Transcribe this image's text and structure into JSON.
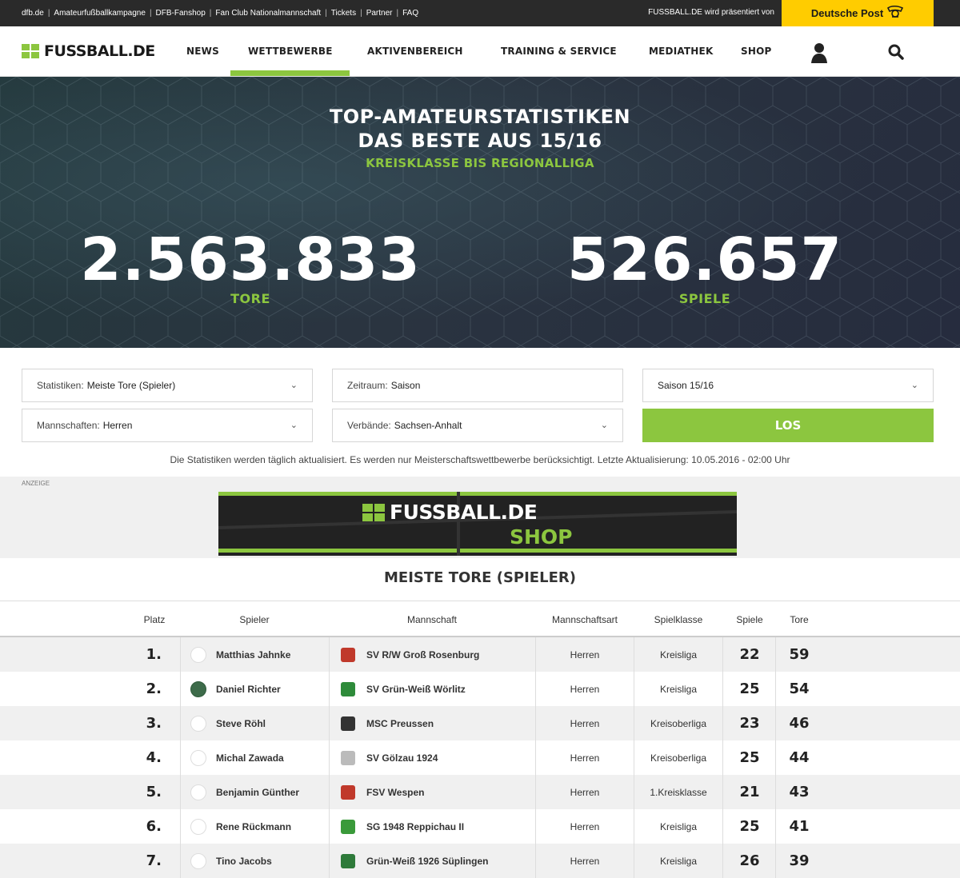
{
  "topbar": {
    "links": [
      "dfb.de",
      "Amateurfußballkampagne",
      "DFB-Fanshop",
      "Fan Club Nationalmannschaft",
      "Tickets",
      "Partner",
      "FAQ"
    ],
    "presented": "FUSSBALL.DE wird präsentiert von",
    "sponsor": "Deutsche Post"
  },
  "nav": {
    "logo": "FUSSBALL.DE",
    "items": [
      "NEWS",
      "WETTBEWERBE",
      "AKTIVENBEREICH",
      "TRAINING & SERVICE",
      "MEDIATHEK",
      "SHOP"
    ],
    "active": "WETTBEWERBE"
  },
  "hero": {
    "title1": "TOP-AMATEURSTATISTIKEN",
    "title2": "DAS BESTE AUS 15/16",
    "subtitle": "KREISKLASSE BIS REGIONALLIGA",
    "goals_value": "2.563.833",
    "goals_label": "TORE",
    "games_value": "526.657",
    "games_label": "SPIELE"
  },
  "filters": {
    "stat_label": "Statistiken:",
    "stat_value": "Meiste Tore (Spieler)",
    "period_label": "Zeitraum:",
    "period_value": "Saison",
    "season_value": "Saison 15/16",
    "teams_label": "Mannschaften:",
    "teams_value": "Herren",
    "assoc_label": "Verbände:",
    "assoc_value": "Sachsen-Anhalt",
    "submit": "LOS",
    "info": "Die Statistiken werden täglich aktualisiert. Es werden nur Meisterschaftswettbewerbe berücksichtigt. Letzte Aktualisierung: 10.05.2016 - 02:00 Uhr"
  },
  "ad": {
    "label": "ANZEIGE",
    "logo": "FUSSBALL.DE",
    "shop": "SHOP"
  },
  "table": {
    "title": "MEISTE TORE (SPIELER)",
    "headers": [
      "Platz",
      "Spieler",
      "Mannschaft",
      "Mannschaftsart",
      "Spielklasse",
      "Spiele",
      "Tore"
    ],
    "rows": [
      {
        "rank": "1.",
        "player": "Matthias Jahnke",
        "team": "SV R/W Groß Rosenburg",
        "type": "Herren",
        "league": "Kreisliga",
        "games": "22",
        "goals": "59"
      },
      {
        "rank": "2.",
        "player": "Daniel Richter",
        "team": "SV Grün-Weiß Wörlitz",
        "type": "Herren",
        "league": "Kreisliga",
        "games": "25",
        "goals": "54"
      },
      {
        "rank": "3.",
        "player": "Steve Röhl",
        "team": "MSC Preussen",
        "type": "Herren",
        "league": "Kreisoberliga",
        "games": "23",
        "goals": "46"
      },
      {
        "rank": "4.",
        "player": "Michal Zawada",
        "team": "SV Gölzau 1924",
        "type": "Herren",
        "league": "Kreisoberliga",
        "games": "25",
        "goals": "44"
      },
      {
        "rank": "5.",
        "player": "Benjamin Günther",
        "team": "FSV Wespen",
        "type": "Herren",
        "league": "1.Kreisklasse",
        "games": "21",
        "goals": "43"
      },
      {
        "rank": "6.",
        "player": "Rene Rückmann",
        "team": "SG 1948 Reppichau II",
        "type": "Herren",
        "league": "Kreisliga",
        "games": "25",
        "goals": "41"
      },
      {
        "rank": "7.",
        "player": "Tino Jacobs",
        "team": "Grün-Weiß 1926 Süplingen",
        "type": "Herren",
        "league": "Kreisliga",
        "games": "26",
        "goals": "39"
      }
    ]
  },
  "colors": {
    "accent": "#8cc63f",
    "sponsor": "#ffcc00",
    "topbar": "#2a2a2a",
    "crests": [
      "#c0392b",
      "#2e8b3a",
      "#333333",
      "#bbbbbb",
      "#c0392b",
      "#3a9a3a",
      "#2e7a3a"
    ],
    "avatar_photo_row": 1
  }
}
